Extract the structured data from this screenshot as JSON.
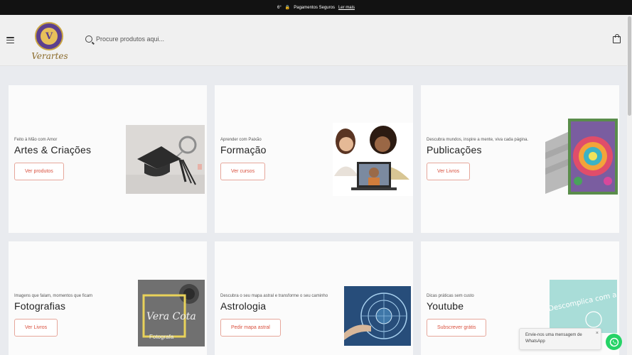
{
  "announcement": {
    "prefix": "6°",
    "text": "Pagamentos Seguros",
    "link": "Ler mais"
  },
  "header": {
    "logo_text": "Verartes",
    "logo_mark": "V",
    "search_placeholder": "Procure produtos aqui..."
  },
  "cards": [
    {
      "subtitle": "Feito à Mão com Amor",
      "title": "Artes & Criações",
      "button": "Ver produtos"
    },
    {
      "subtitle": "Aprender com Paixão",
      "title": "Formação",
      "button": "Ver cursos"
    },
    {
      "subtitle": "Descubra mundos, inspire a mente, viva cada página.",
      "title": "Publicações",
      "button": "Ver Livros"
    },
    {
      "subtitle": "Imagens que falam, momentos que ficam",
      "title": "Fotografias",
      "button": "Ver Livros"
    },
    {
      "subtitle": "Descubra o seu mapa astral e transforme o seu caminho",
      "title": "Astrologia",
      "button": "Pedir mapa astral"
    },
    {
      "subtitle": "Dicas práticas sem custo",
      "title": "Youtube",
      "button": "Subscrever grátis"
    }
  ],
  "images": {
    "photo_sign": "Vera Cota",
    "photo_caption": "Fotografa",
    "youtube_text": "Descomplica com a"
  },
  "whatsapp": {
    "message": "Envie-nos uma mensagem de WhatsApp",
    "close": "×"
  },
  "colors": {
    "accent": "#d9503e",
    "whatsapp": "#25d366",
    "topbar": "#121212"
  }
}
